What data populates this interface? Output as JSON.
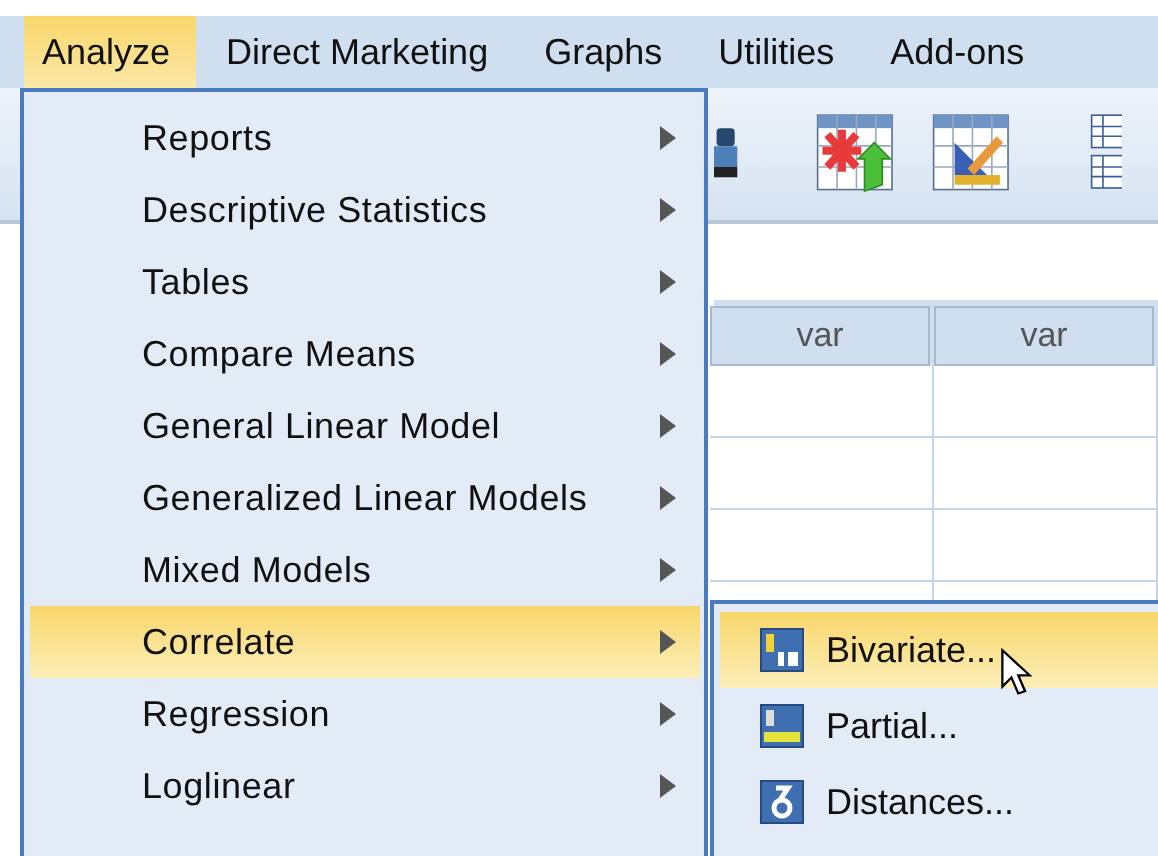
{
  "menubar": [
    {
      "label": "Analyze",
      "selected": true
    },
    {
      "label": "Direct Marketing",
      "selected": false
    },
    {
      "label": "Graphs",
      "selected": false
    },
    {
      "label": "Utilities",
      "selected": false
    },
    {
      "label": "Add-ons",
      "selected": false
    }
  ],
  "grid": {
    "columns": [
      "var",
      "var"
    ]
  },
  "menu": [
    {
      "label": "Reports",
      "selected": false
    },
    {
      "label": "Descriptive Statistics",
      "selected": false
    },
    {
      "label": "Tables",
      "selected": false
    },
    {
      "label": "Compare Means",
      "selected": false
    },
    {
      "label": "General Linear Model",
      "selected": false
    },
    {
      "label": "Generalized Linear Models",
      "selected": false
    },
    {
      "label": "Mixed Models",
      "selected": false
    },
    {
      "label": "Correlate",
      "selected": true
    },
    {
      "label": "Regression",
      "selected": false
    },
    {
      "label": "Loglinear",
      "selected": false
    }
  ],
  "submenu": [
    {
      "label": "Bivariate...",
      "kind": "bivariate",
      "selected": true
    },
    {
      "label": "Partial...",
      "kind": "partial",
      "selected": false
    },
    {
      "label": "Distances...",
      "kind": "distances",
      "selected": false
    }
  ]
}
